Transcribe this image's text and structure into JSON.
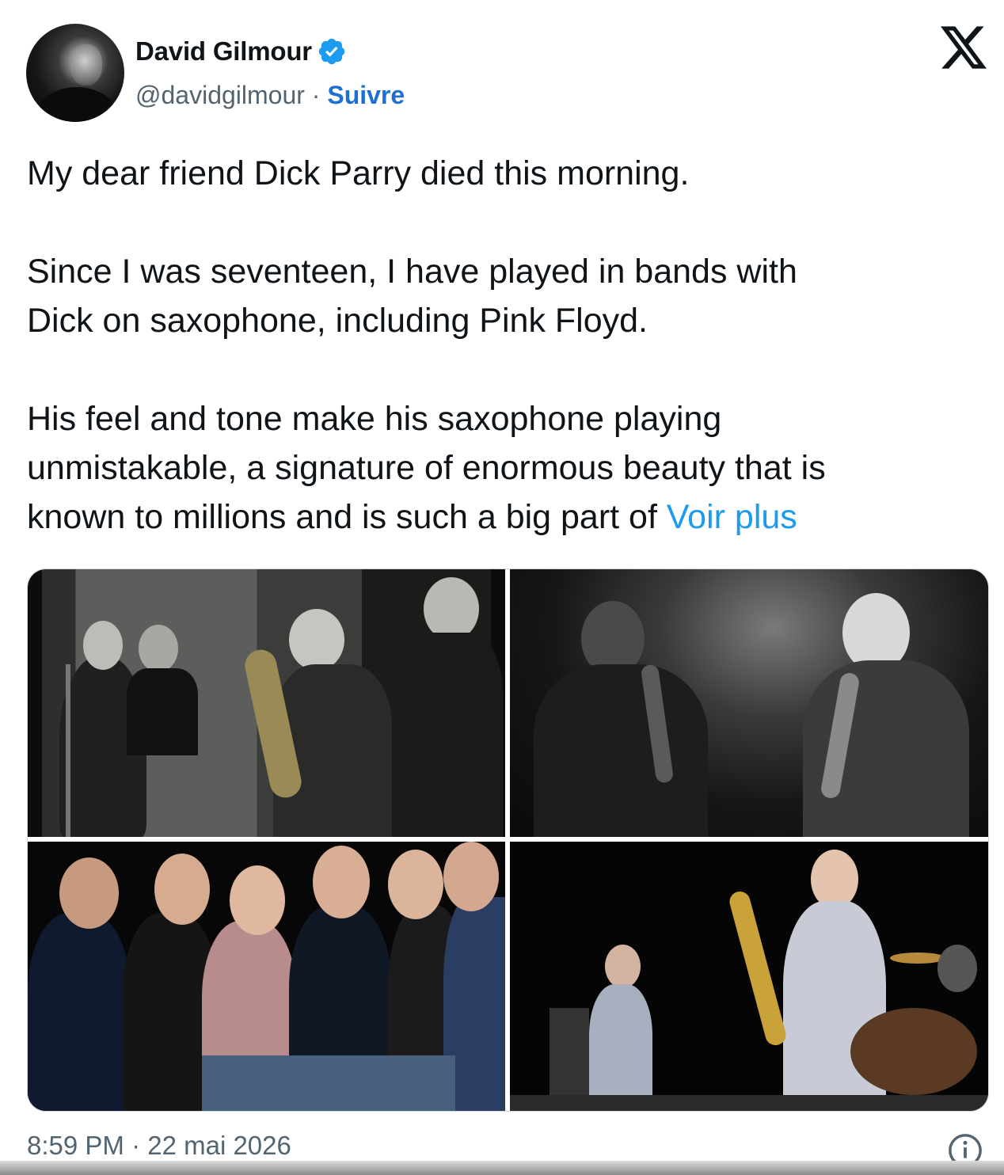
{
  "author": {
    "name": "David Gilmour",
    "handle": "@davidgilmour",
    "separator": " · ",
    "follow_label": "Suivre",
    "verified": true
  },
  "brand_icon": "x-logo-icon",
  "tweet": {
    "text": "My dear friend Dick Parry died this morning.\n\nSince I was seventeen, I have played in bands with\nDick on saxophone, including Pink Floyd.\n\nHis feel and tone make his saxophone playing\nunmistakable, a signature of enormous beauty that is\nknown to millions and is such a big part of ",
    "more_label": "Voir plus"
  },
  "media": {
    "photos": [
      {
        "icon": "bw-band-photo-1960s"
      },
      {
        "icon": "bw-saxophone-stage-photo"
      },
      {
        "icon": "group-portrait-photo"
      },
      {
        "icon": "concert-stage-photo"
      }
    ]
  },
  "footer": {
    "timestamp": "8:59 PM · 22 mai 2026",
    "info_icon": "info-icon"
  },
  "colors": {
    "accent": "#1d9bf0",
    "follow": "#1d6fd1",
    "secondary_text": "#536471",
    "verified_badge": "#1d9bf0"
  }
}
